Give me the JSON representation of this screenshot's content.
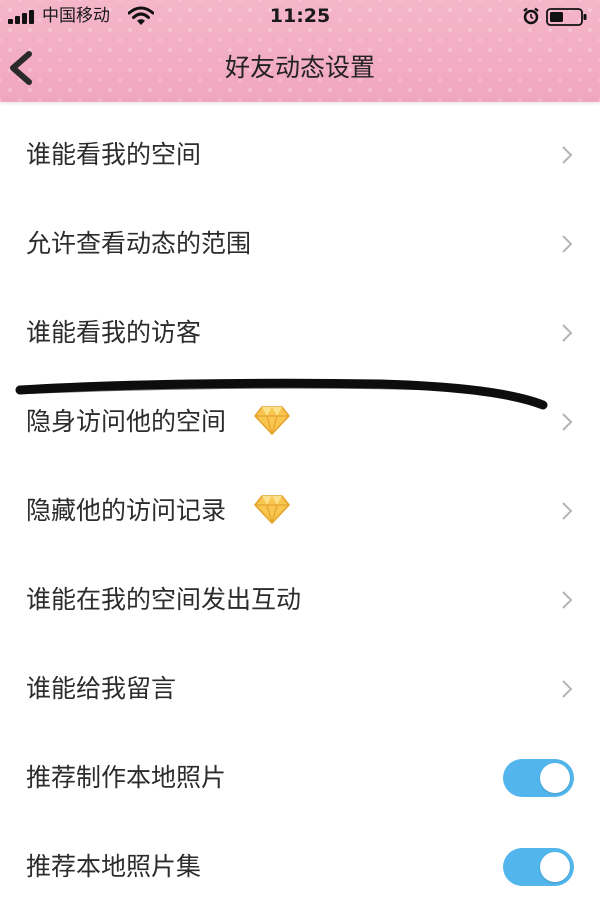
{
  "status_bar": {
    "carrier": "中国移动",
    "time": "11:25"
  },
  "nav": {
    "title": "好友动态设置"
  },
  "rows": [
    {
      "label": "谁能看我的空间",
      "control": "chevron",
      "vip": false
    },
    {
      "label": "允许查看动态的范围",
      "control": "chevron",
      "vip": false
    },
    {
      "label": "谁能看我的访客",
      "control": "chevron",
      "vip": false
    },
    {
      "label": "隐身访问他的空间",
      "control": "chevron",
      "vip": true
    },
    {
      "label": "隐藏他的访问记录",
      "control": "chevron",
      "vip": true
    },
    {
      "label": "谁能在我的空间发出互动",
      "control": "chevron",
      "vip": false
    },
    {
      "label": "谁能给我留言",
      "control": "chevron",
      "vip": false
    },
    {
      "label": "推荐制作本地照片",
      "control": "toggle",
      "toggle_on": true
    },
    {
      "label": "推荐本地照片集",
      "control": "toggle",
      "toggle_on": true
    }
  ],
  "colors": {
    "header_pink": "#f3aec4",
    "toggle_on": "#52b6ec",
    "chevron": "#b5b5b5",
    "gem_gold": "#f5b93a"
  },
  "icons": {
    "back": "chevron-left-icon",
    "row_arrow": "chevron-right-icon",
    "vip": "diamond-icon",
    "signal": "cellular-signal-icon",
    "wifi": "wifi-icon",
    "alarm": "alarm-clock-icon",
    "battery": "battery-icon"
  }
}
